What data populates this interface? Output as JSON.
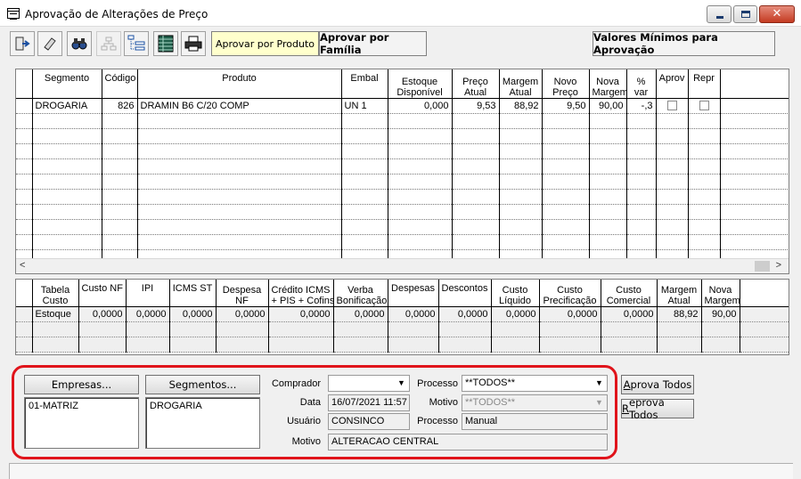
{
  "window": {
    "title": "Aprovação de Alterações de Preço",
    "controls": {
      "minimize": "min",
      "maximize": "max",
      "close": "x"
    }
  },
  "toolbar": {
    "icons": [
      "exit-icon",
      "eraser-icon",
      "binoculars-icon",
      "hierarchy-icon",
      "tree-list-icon",
      "spreadsheet-icon",
      "printer-icon"
    ],
    "approve_by_product": "Aprovar por Produto",
    "approve_by_family": "Aprovar por Família",
    "minimum_values": "Valores Mínimos para Aprovação"
  },
  "products_grid": {
    "headers": {
      "segmento": "Segmento",
      "codigo": "Código",
      "produto": "Produto",
      "embal": "Embal",
      "estoque1": "Estoque",
      "estoque2": "Disponível",
      "preco1": "Preço",
      "preco2": "Atual",
      "margem1": "Margem",
      "margem2": "Atual",
      "novo1": "Novo",
      "novo2": "Preço",
      "nova1": "Nova",
      "nova2": "Margem",
      "var1": "%",
      "var2": "var",
      "aprov": "Aprov",
      "repr": "Repr"
    },
    "row": {
      "segmento": "DROGARIA",
      "codigo": "826",
      "produto": "DRAMIN B6 C/20 COMP",
      "embal": "UN  1",
      "estoque": "0,000",
      "preco_atual": "9,53",
      "margem_atual": "88,92",
      "novo_preco": "9,50",
      "nova_margem": "90,00",
      "var": "-,3"
    }
  },
  "cost_grid": {
    "headers": {
      "tabela1": "Tabela",
      "tabela2": "Custo",
      "custo_nf": "Custo NF",
      "ipi": "IPI",
      "icms_st": "ICMS ST",
      "despesa1": "Despesa",
      "despesa2": "NF",
      "credito1": "Crédito ICMS",
      "credito2": "+ PIS + Cofins",
      "verba1": "Verba",
      "verba2": "Bonificação",
      "despesas": "Despesas",
      "descontos": "Descontos",
      "liquido1": "Custo",
      "liquido2": "Líquido",
      "precif1": "Custo",
      "precif2": "Precificação",
      "comercial1": "Custo",
      "comercial2": "Comercial",
      "margem1": "Margem",
      "margem2": "Atual",
      "nova1": "Nova",
      "nova2": "Margem"
    },
    "row": {
      "tabela": "Estoque",
      "custo_nf": "0,0000",
      "ipi": "0,0000",
      "icms_st": "0,0000",
      "despesa_nf": "0,0000",
      "credito": "0,0000",
      "verba": "0,0000",
      "despesas": "0,0000",
      "descontos": "0,0000",
      "liquido": "0,0000",
      "precificacao": "0,0000",
      "comercial": "0,0000",
      "margem_atual": "88,92",
      "nova_margem": "90,00"
    }
  },
  "filters": {
    "empresas_button": "Empresas...",
    "empresas_list": [
      "01-MATRIZ"
    ],
    "segmentos_button": "Segmentos...",
    "segmentos_list": [
      "DROGARIA"
    ],
    "comprador_label": "Comprador",
    "comprador_value": "",
    "data_label": "Data",
    "data_value": "16/07/2021 11:57",
    "usuario_label": "Usuário",
    "usuario_value": "CONSINCO",
    "motivo_label": "Motivo",
    "motivo_value": "ALTERACAO CENTRAL",
    "processo_label": "Processo",
    "processo_value": "**TODOS**",
    "motivo2_label": "Motivo",
    "motivo2_value": "**TODOS**",
    "processo2_label": "Processo",
    "processo2_value": "Manual",
    "aprova_todos_first": "A",
    "aprova_todos_rest": "prova Todos",
    "reprova_todos_first": "R",
    "reprova_todos_rest": "eprova Todos"
  }
}
